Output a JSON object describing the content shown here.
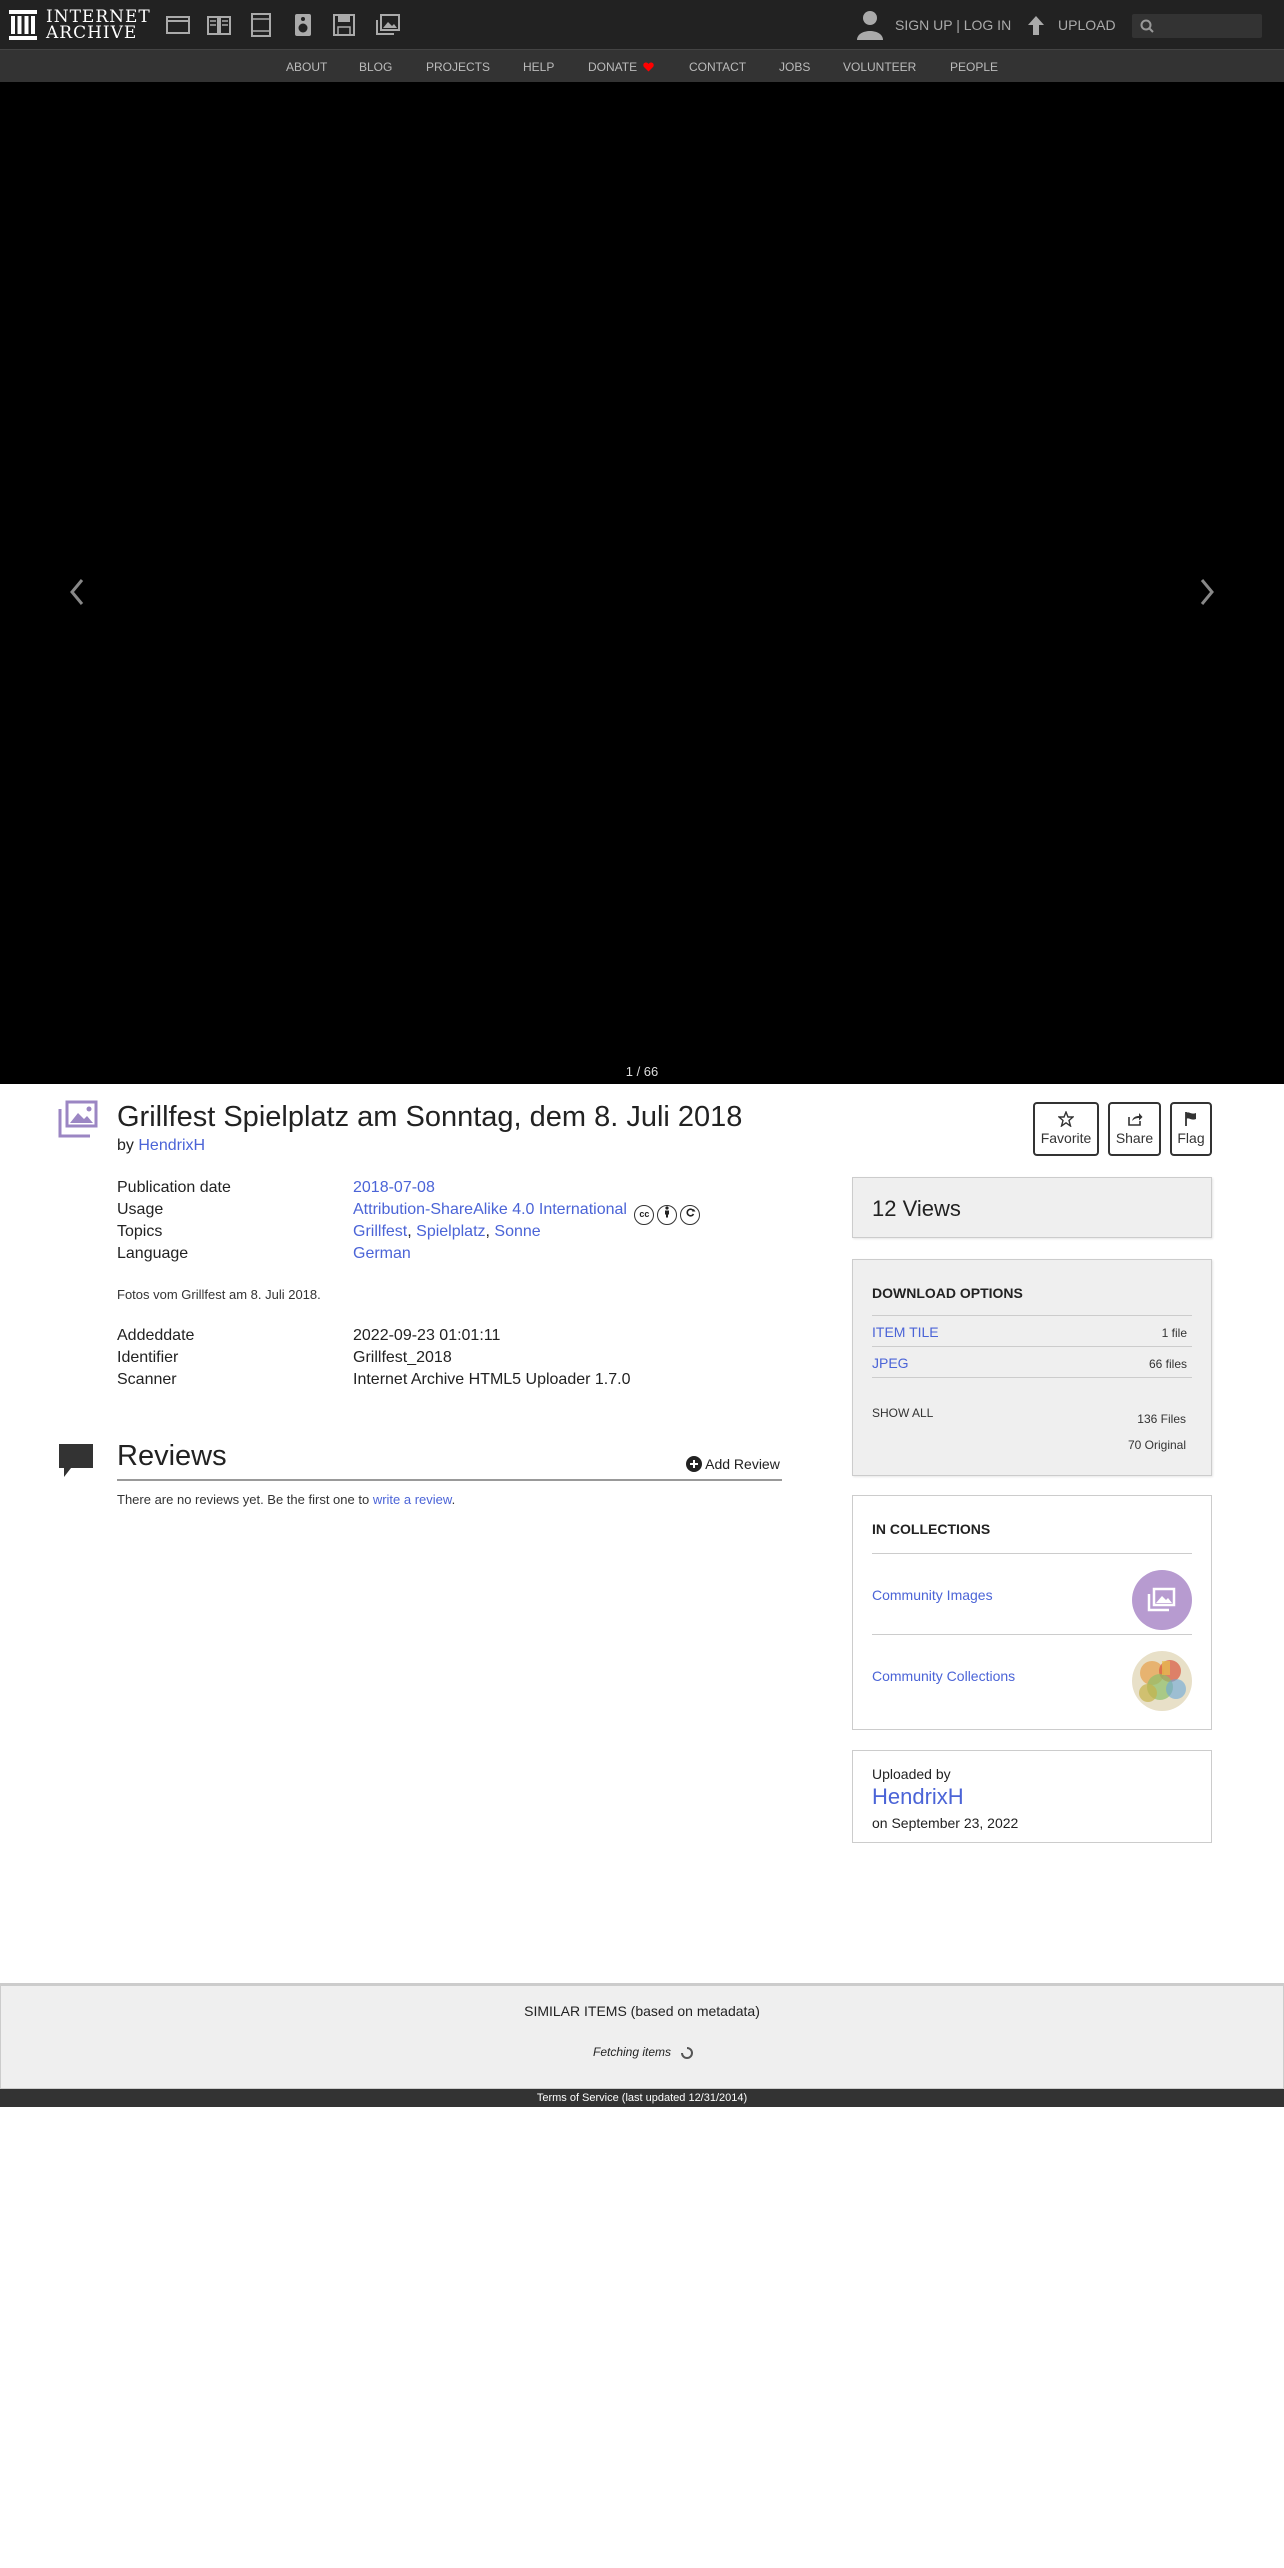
{
  "brand": {
    "line1": "INTERNET",
    "line2": "ARCHIVE"
  },
  "topbar": {
    "media_icons": [
      "web-icon",
      "texts-icon",
      "video-icon",
      "audio-icon",
      "software-icon",
      "images-icon"
    ],
    "signup_login": "SIGN UP | LOG IN",
    "upload": "UPLOAD",
    "search_placeholder": "Search"
  },
  "nav": {
    "items": [
      "ABOUT",
      "BLOG",
      "PROJECTS",
      "HELP",
      "DONATE",
      "CONTACT",
      "JOBS",
      "VOLUNTEER",
      "PEOPLE"
    ],
    "donate_heart_color": "#ff0000"
  },
  "viewer": {
    "page_counter": "1 / 66"
  },
  "item": {
    "title": "Grillfest Spielplatz am Sonntag, dem 8. Juli 2018",
    "by_prefix": "by",
    "creator": "HendrixH",
    "actions": {
      "favorite": "Favorite",
      "share": "Share",
      "flag": "Flag"
    }
  },
  "metadata": {
    "publication_date_label": "Publication date",
    "publication_date": "2018-07-08",
    "usage_label": "Usage",
    "usage": "Attribution-ShareAlike 4.0 International",
    "cc_badges": [
      "cc",
      "by",
      "sa"
    ],
    "topics_label": "Topics",
    "topics": [
      "Grillfest",
      "Spielplatz",
      "Sonne"
    ],
    "topics_sep": ",",
    "language_label": "Language",
    "language": "German",
    "description": "Fotos vom Grillfest am 8. Juli 2018.",
    "addeddate_label": "Addeddate",
    "addeddate": "2022-09-23 01:01:11",
    "identifier_label": "Identifier",
    "identifier": "Grillfest_2018",
    "scanner_label": "Scanner",
    "scanner": "Internet Archive HTML5 Uploader 1.7.0"
  },
  "reviews": {
    "title": "Reviews",
    "add_review": "Add Review",
    "empty_prefix": "There are no reviews yet. Be the first one to",
    "empty_link": "write a review",
    "empty_suffix": "."
  },
  "sidebar": {
    "views": "12 Views",
    "download_heading": "DOWNLOAD OPTIONS",
    "downloads": [
      {
        "name": "ITEM TILE",
        "count": "1 file"
      },
      {
        "name": "JPEG",
        "count": "66 files"
      }
    ],
    "show_all": "SHOW ALL",
    "total_files": "136 Files",
    "original_files": "70 Original",
    "collections_heading": "IN COLLECTIONS",
    "collections": [
      {
        "name": "Community Images",
        "thumb": "community-images-thumb"
      },
      {
        "name": "Community Collections",
        "thumb": "community-collections-thumb"
      }
    ],
    "uploaded_by_label": "Uploaded by",
    "uploader": "HendrixH",
    "uploaded_on": "on September 23, 2022"
  },
  "similar": {
    "title": "SIMILAR ITEMS (based on metadata)",
    "status": "Fetching items"
  },
  "footer": {
    "text": "Terms of Service (last updated 12/31/2014)"
  },
  "colors": {
    "link": "#4b64d7",
    "topbar": "#222222",
    "navbar": "#333333",
    "image_icon": "#9b86c3"
  }
}
